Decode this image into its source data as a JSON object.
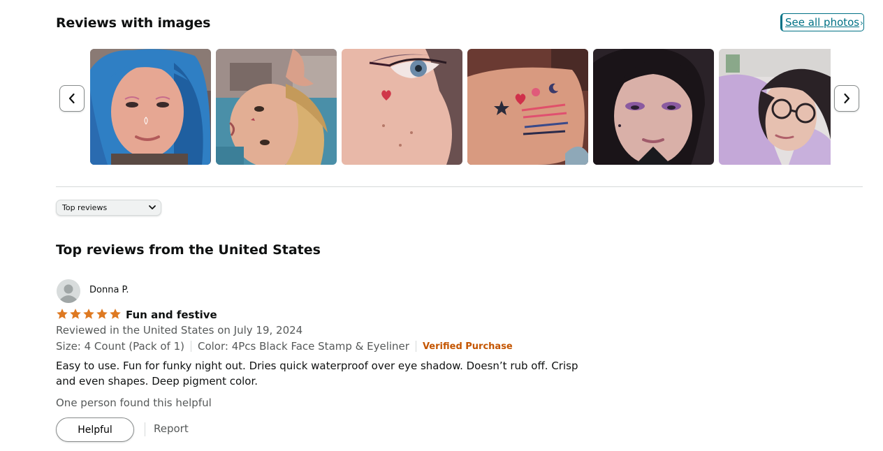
{
  "reviews_with_images": {
    "title": "Reviews with images",
    "see_all_label": "See all photos",
    "see_all_chevron": "›",
    "prev_icon": "chevron-left-icon",
    "next_icon": "chevron-right-icon",
    "thumbnails": [
      {
        "name": "review-photo-blue-hair"
      },
      {
        "name": "review-photo-child"
      },
      {
        "name": "review-photo-eye-heart"
      },
      {
        "name": "review-photo-hand-stamps"
      },
      {
        "name": "review-photo-purple-makeup"
      },
      {
        "name": "review-photo-glasses"
      }
    ]
  },
  "sort": {
    "selected": "Top reviews",
    "icon": "chevron-down-icon"
  },
  "top_reviews": {
    "title": "Top reviews from the United States"
  },
  "review": {
    "reviewer": "Donna P.",
    "rating": 5,
    "rating_max": 5,
    "title": "Fun and festive",
    "date_line": "Reviewed in the United States on July 19, 2024",
    "size": "Size: 4 Count (Pack of 1)",
    "color": "Color: 4Pcs Black Face Stamp & Eyeliner",
    "verified": "Verified Purchase",
    "body": "Easy to use. Fun for funky night out. Dries quick waterproof over eye shadow. Doesn’t rub off. Crisp and even shapes. Deep pigment color.",
    "helpful_count": "One person found this helpful",
    "helpful_label": "Helpful",
    "report_label": "Report"
  },
  "colors": {
    "link": "#007185",
    "star": "#de7921",
    "verified": "#c45500",
    "muted_text": "#565959"
  }
}
